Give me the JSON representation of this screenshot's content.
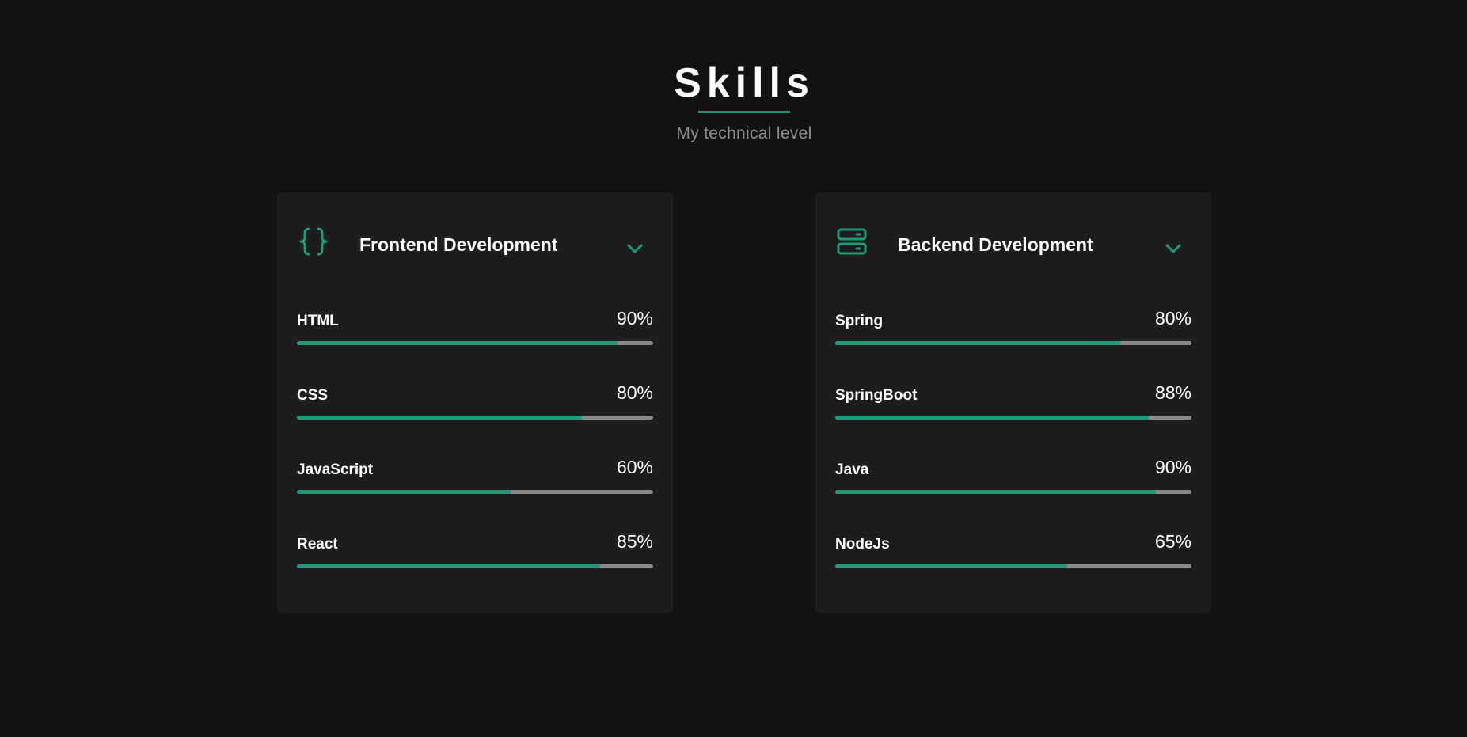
{
  "header": {
    "title": "Skills",
    "subtitle": "My technical level"
  },
  "colors": {
    "accent": "#219a7b",
    "background": "#121212",
    "card": "#1d1d1d",
    "track": "#8a8a8a"
  },
  "cards": [
    {
      "title": "Frontend Development",
      "icon": "code-braces-icon",
      "skills": [
        {
          "name": "HTML",
          "percent_label": "90%",
          "level": 0.9
        },
        {
          "name": "CSS",
          "percent_label": "80%",
          "level": 0.8
        },
        {
          "name": "JavaScript",
          "percent_label": "60%",
          "level": 0.6
        },
        {
          "name": "React",
          "percent_label": "85%",
          "level": 0.85
        }
      ]
    },
    {
      "title": "Backend Development",
      "icon": "server-icon",
      "skills": [
        {
          "name": "Spring",
          "percent_label": "80%",
          "level": 0.8
        },
        {
          "name": "SpringBoot",
          "percent_label": "88%",
          "level": 0.88
        },
        {
          "name": "Java",
          "percent_label": "90%",
          "level": 0.9
        },
        {
          "name": "NodeJs",
          "percent_label": "65%",
          "level": 0.65
        }
      ]
    }
  ]
}
